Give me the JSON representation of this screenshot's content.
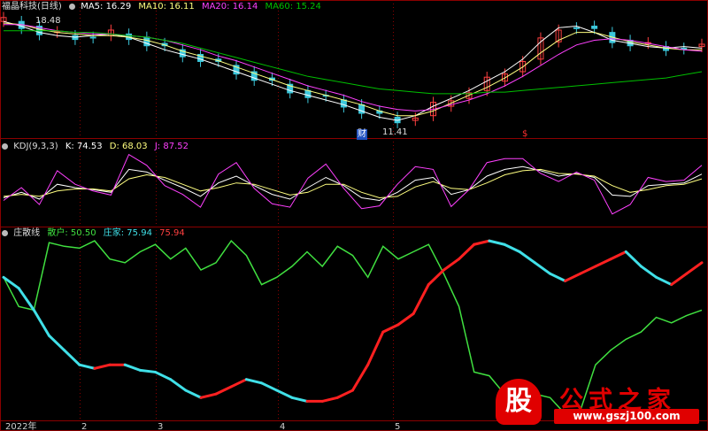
{
  "colors": {
    "background": "#000000",
    "grid": "#8b0000",
    "up": "#ff4040",
    "down": "#3cc8dc",
    "ma5": "#ffffff",
    "ma10": "#ffff80",
    "ma20": "#ff40ff",
    "ma60": "#00c000",
    "kdj_k": "#ffffff",
    "kdj_d": "#ffff80",
    "kdj_j": "#ff40ff",
    "retail": "#40e040",
    "dealer_up": "#ff2020",
    "dealer_down": "#40e0e8"
  },
  "price_panel": {
    "title": "福晶科技(日线)",
    "ma5": "MA5: 16.29",
    "ma10": "MA10: 16.11",
    "ma20": "MA20: 16.14",
    "ma60": "MA60: 15.24",
    "high_label": "18.48",
    "low_label": "11.41",
    "marker_cai": "财",
    "marker_dollar": "$"
  },
  "kdj_panel": {
    "title": "KDJ(9,3,3)",
    "k": "K: 74.53",
    "d": "D: 68.03",
    "j": "J: 87.52"
  },
  "zhuangsan_panel": {
    "title": "庄散线",
    "retail": "散户: 50.50",
    "dealer": "庄家: 75.94",
    "last": "75.94"
  },
  "time_axis": [
    "2022年",
    "2",
    "3",
    "4",
    "5"
  ],
  "watermark": {
    "glyph": "股",
    "brand": "公式之家",
    "site": "www.gszj100.com"
  },
  "chart_data": {
    "type": "line",
    "price_axis_range": [
      11,
      19
    ],
    "series": [
      {
        "name": "MA5",
        "values": [
          18.2,
          17.9,
          17.5,
          17.3,
          17.2,
          17.3,
          17.4,
          17.2,
          16.8,
          16.4,
          16.1,
          15.8,
          15.4,
          15.0,
          14.6,
          14.2,
          13.8,
          13.5,
          13.2,
          12.9,
          12.5,
          12.1,
          11.9,
          12.2,
          12.8,
          13.3,
          13.8,
          14.4,
          15.0,
          15.8,
          16.9,
          17.8,
          17.9,
          17.5,
          17.0,
          16.8,
          16.6,
          16.5,
          16.6,
          16.5
        ]
      },
      {
        "name": "MA10",
        "values": [
          18.1,
          18.0,
          17.7,
          17.5,
          17.4,
          17.3,
          17.3,
          17.2,
          17.0,
          16.7,
          16.3,
          16.0,
          15.7,
          15.3,
          14.9,
          14.5,
          14.1,
          13.8,
          13.5,
          13.2,
          12.9,
          12.5,
          12.2,
          12.2,
          12.5,
          13.0,
          13.5,
          14.0,
          14.6,
          15.3,
          16.2,
          17.0,
          17.5,
          17.5,
          17.2,
          16.9,
          16.7,
          16.5,
          16.4,
          16.4
        ]
      },
      {
        "name": "MA20",
        "values": [
          18.0,
          18.0,
          17.8,
          17.6,
          17.5,
          17.4,
          17.4,
          17.3,
          17.2,
          17.0,
          16.7,
          16.4,
          16.0,
          15.7,
          15.3,
          14.9,
          14.5,
          14.1,
          13.8,
          13.5,
          13.1,
          12.8,
          12.6,
          12.5,
          12.6,
          12.9,
          13.2,
          13.6,
          14.1,
          14.7,
          15.4,
          16.1,
          16.7,
          17.0,
          17.1,
          17.0,
          16.8,
          16.6,
          16.4,
          16.3
        ]
      },
      {
        "name": "MA60",
        "values": [
          17.6,
          17.6,
          17.6,
          17.6,
          17.5,
          17.5,
          17.4,
          17.3,
          17.2,
          17.0,
          16.8,
          16.5,
          16.2,
          15.9,
          15.6,
          15.3,
          15.0,
          14.7,
          14.5,
          14.3,
          14.1,
          13.9,
          13.8,
          13.7,
          13.6,
          13.6,
          13.6,
          13.7,
          13.7,
          13.8,
          13.9,
          14.0,
          14.1,
          14.2,
          14.3,
          14.4,
          14.5,
          14.6,
          14.8,
          15.0
        ]
      }
    ],
    "kdj_axis_range": [
      0,
      110
    ],
    "kdj_series": [
      {
        "name": "K",
        "values": [
          40,
          48,
          38,
          60,
          55,
          52,
          48,
          82,
          78,
          66,
          55,
          42,
          62,
          72,
          58,
          45,
          38,
          55,
          70,
          58,
          40,
          36,
          48,
          66,
          70,
          45,
          52,
          72,
          82,
          86,
          80,
          72,
          76,
          70,
          44,
          42,
          58,
          60,
          62,
          75
        ]
      },
      {
        "name": "D",
        "values": [
          42,
          45,
          42,
          50,
          53,
          53,
          50,
          68,
          74,
          70,
          60,
          50,
          55,
          62,
          60,
          52,
          44,
          48,
          60,
          60,
          48,
          40,
          42,
          56,
          64,
          54,
          52,
          62,
          74,
          80,
          82,
          76,
          75,
          72,
          58,
          48,
          52,
          58,
          60,
          68
        ]
      },
      {
        "name": "J",
        "values": [
          36,
          55,
          30,
          80,
          60,
          50,
          44,
          104,
          88,
          58,
          45,
          26,
          75,
          92,
          54,
          31,
          26,
          69,
          90,
          54,
          24,
          28,
          60,
          86,
          82,
          27,
          52,
          92,
          98,
          98,
          76,
          64,
          78,
          66,
          16,
          30,
          70,
          64,
          66,
          88
        ]
      }
    ],
    "zhuangsan_axis_range": [
      0,
      100
    ],
    "zhuangsan_series": [
      {
        "name": "散户",
        "values": [
          78,
          62,
          60,
          97,
          95,
          94,
          98,
          88,
          86,
          92,
          96,
          88,
          94,
          82,
          86,
          98,
          90,
          74,
          78,
          84,
          92,
          84,
          95,
          90,
          78,
          95,
          88,
          92,
          96,
          80,
          62,
          26,
          24,
          14,
          10,
          14,
          12,
          3,
          5,
          30,
          38,
          44,
          48,
          56,
          53,
          57,
          60
        ]
      },
      {
        "name": "庄家",
        "values": [
          78,
          72,
          60,
          46,
          38,
          30,
          28,
          30,
          30,
          27,
          26,
          22,
          16,
          12,
          14,
          18,
          22,
          20,
          16,
          12,
          10,
          10,
          12,
          16,
          30,
          48,
          52,
          58,
          74,
          82,
          88,
          96,
          98,
          96,
          92,
          86,
          80,
          76,
          80,
          84,
          88,
          92,
          84,
          78,
          74,
          80,
          86
        ]
      }
    ]
  }
}
